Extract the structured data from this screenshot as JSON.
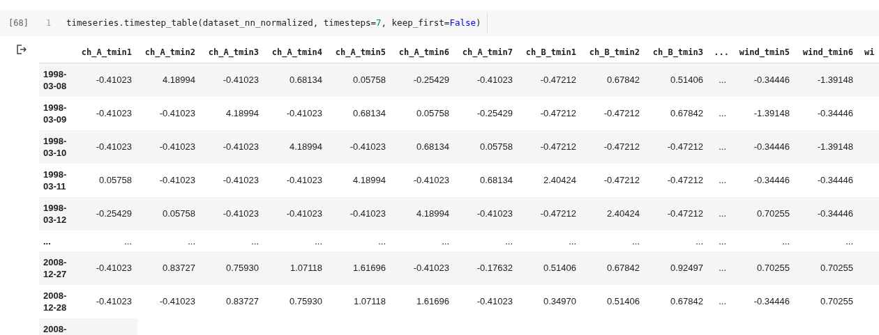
{
  "cell": {
    "execution_count": "[68]",
    "line_number": "1",
    "code_tokens": [
      {
        "text": "timeseries.timestep_table(dataset_nn_normalized, timesteps=",
        "kind": "plain"
      },
      {
        "text": "7",
        "kind": "number"
      },
      {
        "text": ", keep_first=",
        "kind": "plain"
      },
      {
        "text": "False",
        "kind": "keyword"
      },
      {
        "text": ")",
        "kind": "plain"
      }
    ]
  },
  "output": {
    "columns": [
      "ch_A_tmin1",
      "ch_A_tmin2",
      "ch_A_tmin3",
      "ch_A_tmin4",
      "ch_A_tmin5",
      "ch_A_tmin6",
      "ch_A_tmin7",
      "ch_B_tmin1",
      "ch_B_tmin2",
      "ch_B_tmin3",
      "...",
      "wind_tmin5",
      "wind_tmin6",
      "wi"
    ],
    "rows": [
      {
        "index": "1998-03-08",
        "values": [
          "-0.41023",
          "4.18994",
          "-0.41023",
          "0.68134",
          "0.05758",
          "-0.25429",
          "-0.41023",
          "-0.47212",
          "0.67842",
          "0.51406",
          "...",
          "-0.34446",
          "-1.39148"
        ]
      },
      {
        "index": "1998-03-09",
        "values": [
          "-0.41023",
          "-0.41023",
          "4.18994",
          "-0.41023",
          "0.68134",
          "0.05758",
          "-0.25429",
          "-0.47212",
          "-0.47212",
          "0.67842",
          "...",
          "-1.39148",
          "-0.34446"
        ]
      },
      {
        "index": "1998-03-10",
        "values": [
          "-0.41023",
          "-0.41023",
          "-0.41023",
          "4.18994",
          "-0.41023",
          "0.68134",
          "0.05758",
          "-0.47212",
          "-0.47212",
          "-0.47212",
          "...",
          "-0.34446",
          "-1.39148"
        ]
      },
      {
        "index": "1998-03-11",
        "values": [
          "0.05758",
          "-0.41023",
          "-0.41023",
          "-0.41023",
          "4.18994",
          "-0.41023",
          "0.68134",
          "2.40424",
          "-0.47212",
          "-0.47212",
          "...",
          "-0.34446",
          "-0.34446"
        ]
      },
      {
        "index": "1998-03-12",
        "values": [
          "-0.25429",
          "0.05758",
          "-0.41023",
          "-0.41023",
          "-0.41023",
          "4.18994",
          "-0.41023",
          "-0.47212",
          "2.40424",
          "-0.47212",
          "...",
          "0.70255",
          "-0.34446"
        ]
      },
      {
        "index": "...",
        "values": [
          "...",
          "...",
          "...",
          "...",
          "...",
          "...",
          "...",
          "...",
          "...",
          "...",
          "...",
          "...",
          "..."
        ]
      },
      {
        "index": "2008-12-27",
        "values": [
          "-0.41023",
          "0.83727",
          "0.75930",
          "1.07118",
          "1.61696",
          "-0.41023",
          "-0.17632",
          "0.51406",
          "0.67842",
          "0.92497",
          "...",
          "0.70255",
          "0.70255"
        ]
      },
      {
        "index": "2008-12-28",
        "values": [
          "-0.41023",
          "-0.41023",
          "0.83727",
          "0.75930",
          "1.07118",
          "1.61696",
          "-0.41023",
          "0.34970",
          "0.51406",
          "0.67842",
          "...",
          "-0.34446",
          "0.70255"
        ]
      },
      {
        "index": "2008-"
      }
    ]
  }
}
